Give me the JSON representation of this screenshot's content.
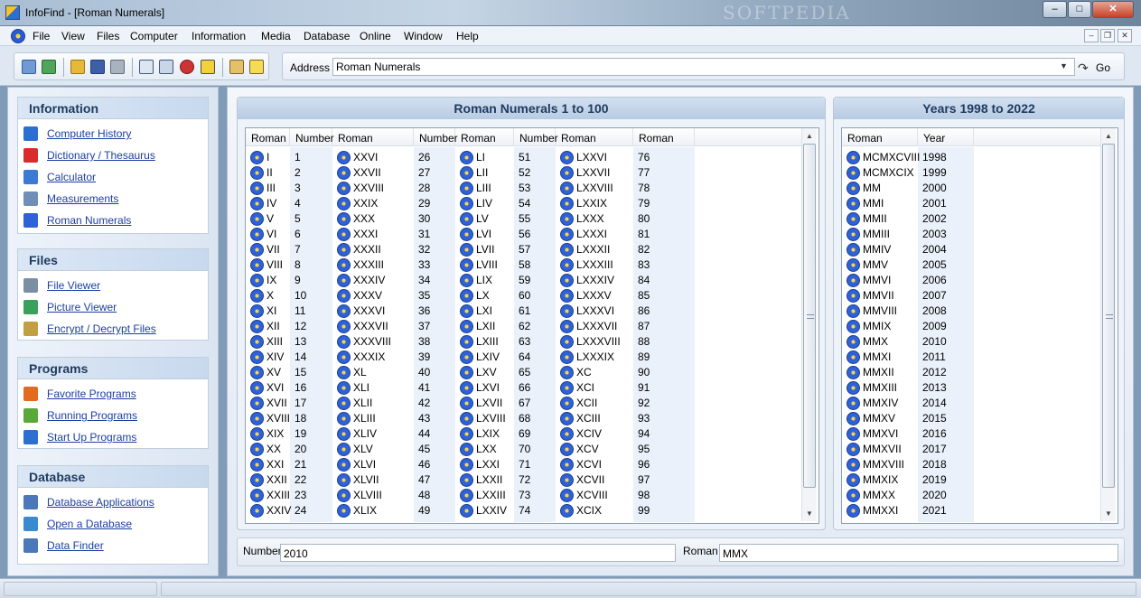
{
  "window": {
    "title": "InfoFind - [Roman Numerals]",
    "watermark": "SOFTPEDIA",
    "minimize": "–",
    "maximize": "□",
    "close": "✕"
  },
  "menubar": {
    "items": [
      "File",
      "View",
      "Files",
      "Computer",
      "Information",
      "Media",
      "Database",
      "Online",
      "Window",
      "Help"
    ]
  },
  "mdi": {
    "minimize": "–",
    "restore": "❐",
    "close": "✕"
  },
  "address": {
    "label": "Address",
    "value": "Roman Numerals",
    "dropdown": "▼",
    "go_icon": "↷",
    "go_label": "Go"
  },
  "sidebar": {
    "groups": [
      {
        "title": "Information",
        "items": [
          {
            "label": "Computer History",
            "icon": "monitor-icon",
            "color": "#2b6fd1"
          },
          {
            "label": "Dictionary / Thesaurus",
            "icon": "dictionary-icon",
            "color": "#d92b2b"
          },
          {
            "label": "Calculator",
            "icon": "calculator-icon",
            "color": "#3a7bd5"
          },
          {
            "label": "Measurements",
            "icon": "ruler-icon",
            "color": "#6f8fb8"
          },
          {
            "label": "Roman Numerals",
            "icon": "globe-icon",
            "color": "#2f61d8"
          }
        ]
      },
      {
        "title": "Files",
        "items": [
          {
            "label": "File Viewer",
            "icon": "files-icon",
            "color": "#7c8ea4"
          },
          {
            "label": "Picture Viewer",
            "icon": "picture-icon",
            "color": "#3aa05b"
          },
          {
            "label": "Encrypt / Decrypt Files",
            "icon": "lock-icon",
            "color": "#c0a040"
          }
        ]
      },
      {
        "title": "Programs",
        "items": [
          {
            "label": "Favorite Programs",
            "icon": "favorites-icon",
            "color": "#e26b1f"
          },
          {
            "label": "Running Programs",
            "icon": "running-icon",
            "color": "#5aa83a"
          },
          {
            "label": "Start Up Programs",
            "icon": "startup-icon",
            "color": "#2b6fd1"
          }
        ]
      },
      {
        "title": "Database",
        "items": [
          {
            "label": "Database Applications",
            "icon": "database-icon",
            "color": "#4a78b8"
          },
          {
            "label": "Open a Database",
            "icon": "open-database-icon",
            "color": "#3a8ad0"
          },
          {
            "label": "Data Finder",
            "icon": "data-finder-icon",
            "color": "#4a78b8"
          }
        ]
      }
    ]
  },
  "roman_panel": {
    "title": "Roman Numerals 1 to 100",
    "columns": [
      "Roman",
      "Number",
      "Roman",
      "Number",
      "Roman",
      "Number",
      "Roman",
      "Roman"
    ],
    "col1": {
      "roman": [
        "I",
        "II",
        "III",
        "IV",
        "V",
        "VI",
        "VII",
        "VIII",
        "IX",
        "X",
        "XI",
        "XII",
        "XIII",
        "XIV",
        "XV",
        "XVI",
        "XVII",
        "XVIII",
        "XIX",
        "XX",
        "XXI",
        "XXII",
        "XXIII",
        "XXIV"
      ],
      "number": [
        "1",
        "2",
        "3",
        "4",
        "5",
        "6",
        "7",
        "8",
        "9",
        "10",
        "11",
        "12",
        "13",
        "14",
        "15",
        "16",
        "17",
        "18",
        "19",
        "20",
        "21",
        "22",
        "23",
        "24"
      ]
    },
    "col2": {
      "roman": [
        "XXVI",
        "XXVII",
        "XXVIII",
        "XXIX",
        "XXX",
        "XXXI",
        "XXXII",
        "XXXIII",
        "XXXIV",
        "XXXV",
        "XXXVI",
        "XXXVII",
        "XXXVIII",
        "XXXIX",
        "XL",
        "XLI",
        "XLII",
        "XLIII",
        "XLIV",
        "XLV",
        "XLVI",
        "XLVII",
        "XLVIII",
        "XLIX"
      ],
      "number": [
        "26",
        "27",
        "28",
        "29",
        "30",
        "31",
        "32",
        "33",
        "34",
        "35",
        "36",
        "37",
        "38",
        "39",
        "40",
        "41",
        "42",
        "43",
        "44",
        "45",
        "46",
        "47",
        "48",
        "49"
      ]
    },
    "col3": {
      "roman": [
        "LI",
        "LII",
        "LIII",
        "LIV",
        "LV",
        "LVI",
        "LVII",
        "LVIII",
        "LIX",
        "LX",
        "LXI",
        "LXII",
        "LXIII",
        "LXIV",
        "LXV",
        "LXVI",
        "LXVII",
        "LXVIII",
        "LXIX",
        "LXX",
        "LXXI",
        "LXXII",
        "LXXIII",
        "LXXIV"
      ],
      "number": [
        "51",
        "52",
        "53",
        "54",
        "55",
        "56",
        "57",
        "58",
        "59",
        "60",
        "61",
        "62",
        "63",
        "64",
        "65",
        "66",
        "67",
        "68",
        "69",
        "70",
        "71",
        "72",
        "73",
        "74"
      ]
    },
    "col4": {
      "roman": [
        "LXXVI",
        "LXXVII",
        "LXXVIII",
        "LXXIX",
        "LXXX",
        "LXXXI",
        "LXXXII",
        "LXXXIII",
        "LXXXIV",
        "LXXXV",
        "LXXXVI",
        "LXXXVII",
        "LXXXVIII",
        "LXXXIX",
        "XC",
        "XCI",
        "XCII",
        "XCIII",
        "XCIV",
        "XCV",
        "XCVI",
        "XCVII",
        "XCVIII",
        "XCIX"
      ],
      "number": [
        "76",
        "77",
        "78",
        "79",
        "80",
        "81",
        "82",
        "83",
        "84",
        "85",
        "86",
        "87",
        "88",
        "89",
        "90",
        "91",
        "92",
        "93",
        "94",
        "95",
        "96",
        "97",
        "98",
        "99"
      ]
    }
  },
  "years_panel": {
    "title": "Years 1998 to 2022",
    "columns": [
      "Roman",
      "Year"
    ],
    "roman": [
      "MCMXCVIII",
      "MCMXCIX",
      "MM",
      "MMI",
      "MMII",
      "MMIII",
      "MMIV",
      "MMV",
      "MMVI",
      "MMVII",
      "MMVIII",
      "MMIX",
      "MMX",
      "MMXI",
      "MMXII",
      "MMXIII",
      "MMXIV",
      "MMXV",
      "MMXVI",
      "MMXVII",
      "MMXVIII",
      "MMXIX",
      "MMXX",
      "MMXXI"
    ],
    "year": [
      "1998",
      "1999",
      "2000",
      "2001",
      "2002",
      "2003",
      "2004",
      "2005",
      "2006",
      "2007",
      "2008",
      "2009",
      "2010",
      "2011",
      "2012",
      "2013",
      "2014",
      "2015",
      "2016",
      "2017",
      "2018",
      "2019",
      "2020",
      "2021"
    ]
  },
  "converter": {
    "number_label": "Number",
    "number_value": "2010",
    "roman_label": "Roman",
    "roman_value": "MMX"
  },
  "scroll": {
    "up": "▲",
    "down": "▼"
  }
}
